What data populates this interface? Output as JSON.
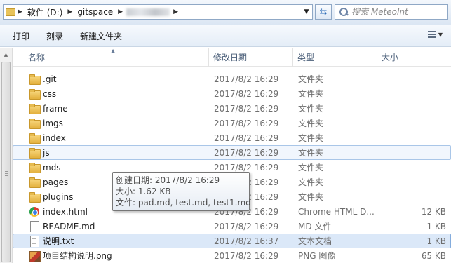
{
  "address_bar": {
    "segments": [
      "软件 (D:)",
      "gitspace"
    ]
  },
  "search": {
    "placeholder": "搜索 MeteoInt"
  },
  "toolbar": {
    "print_label": "打印",
    "burn_label": "刻录",
    "new_folder_label": "新建文件夹"
  },
  "columns": {
    "name": "名称",
    "date": "修改日期",
    "type": "类型",
    "size": "大小"
  },
  "files": [
    {
      "name": ".git",
      "date": "2017/8/2 16:29",
      "type": "文件夹",
      "size": "",
      "icon": "folder-icon"
    },
    {
      "name": "css",
      "date": "2017/8/2 16:29",
      "type": "文件夹",
      "size": "",
      "icon": "folder-icon"
    },
    {
      "name": "frame",
      "date": "2017/8/2 16:29",
      "type": "文件夹",
      "size": "",
      "icon": "folder-icon"
    },
    {
      "name": "imgs",
      "date": "2017/8/2 16:29",
      "type": "文件夹",
      "size": "",
      "icon": "folder-icon"
    },
    {
      "name": "index",
      "date": "2017/8/2 16:29",
      "type": "文件夹",
      "size": "",
      "icon": "folder-icon"
    },
    {
      "name": "js",
      "date": "2017/8/2 16:29",
      "type": "文件夹",
      "size": "",
      "icon": "folder-icon"
    },
    {
      "name": "mds",
      "date": "2017/8/2 16:29",
      "type": "文件夹",
      "size": "",
      "icon": "folder-icon"
    },
    {
      "name": "pages",
      "date": "2017/8/2 16:29",
      "type": "文件夹",
      "size": "",
      "icon": "folder-icon"
    },
    {
      "name": "plugins",
      "date": "2017/8/2 16:29",
      "type": "文件夹",
      "size": "",
      "icon": "folder-icon"
    },
    {
      "name": "index.html",
      "date": "2017/8/2 16:29",
      "type": "Chrome HTML D...",
      "size": "12 KB",
      "icon": "chrome-icon"
    },
    {
      "name": "README.md",
      "date": "2017/8/2 16:29",
      "type": "MD 文件",
      "size": "1 KB",
      "icon": "document-icon"
    },
    {
      "name": "说明.txt",
      "date": "2017/8/2 16:37",
      "type": "文本文档",
      "size": "1 KB",
      "icon": "document-icon"
    },
    {
      "name": "项目结构说明.png",
      "date": "2017/8/2 16:29",
      "type": "PNG 图像",
      "size": "65 KB",
      "icon": "image-icon"
    }
  ],
  "tooltip": {
    "created": "创建日期: 2017/8/2 16:29",
    "size": "大小: 1.62 KB",
    "files": "文件: pad.md, test.md, test1.md"
  }
}
